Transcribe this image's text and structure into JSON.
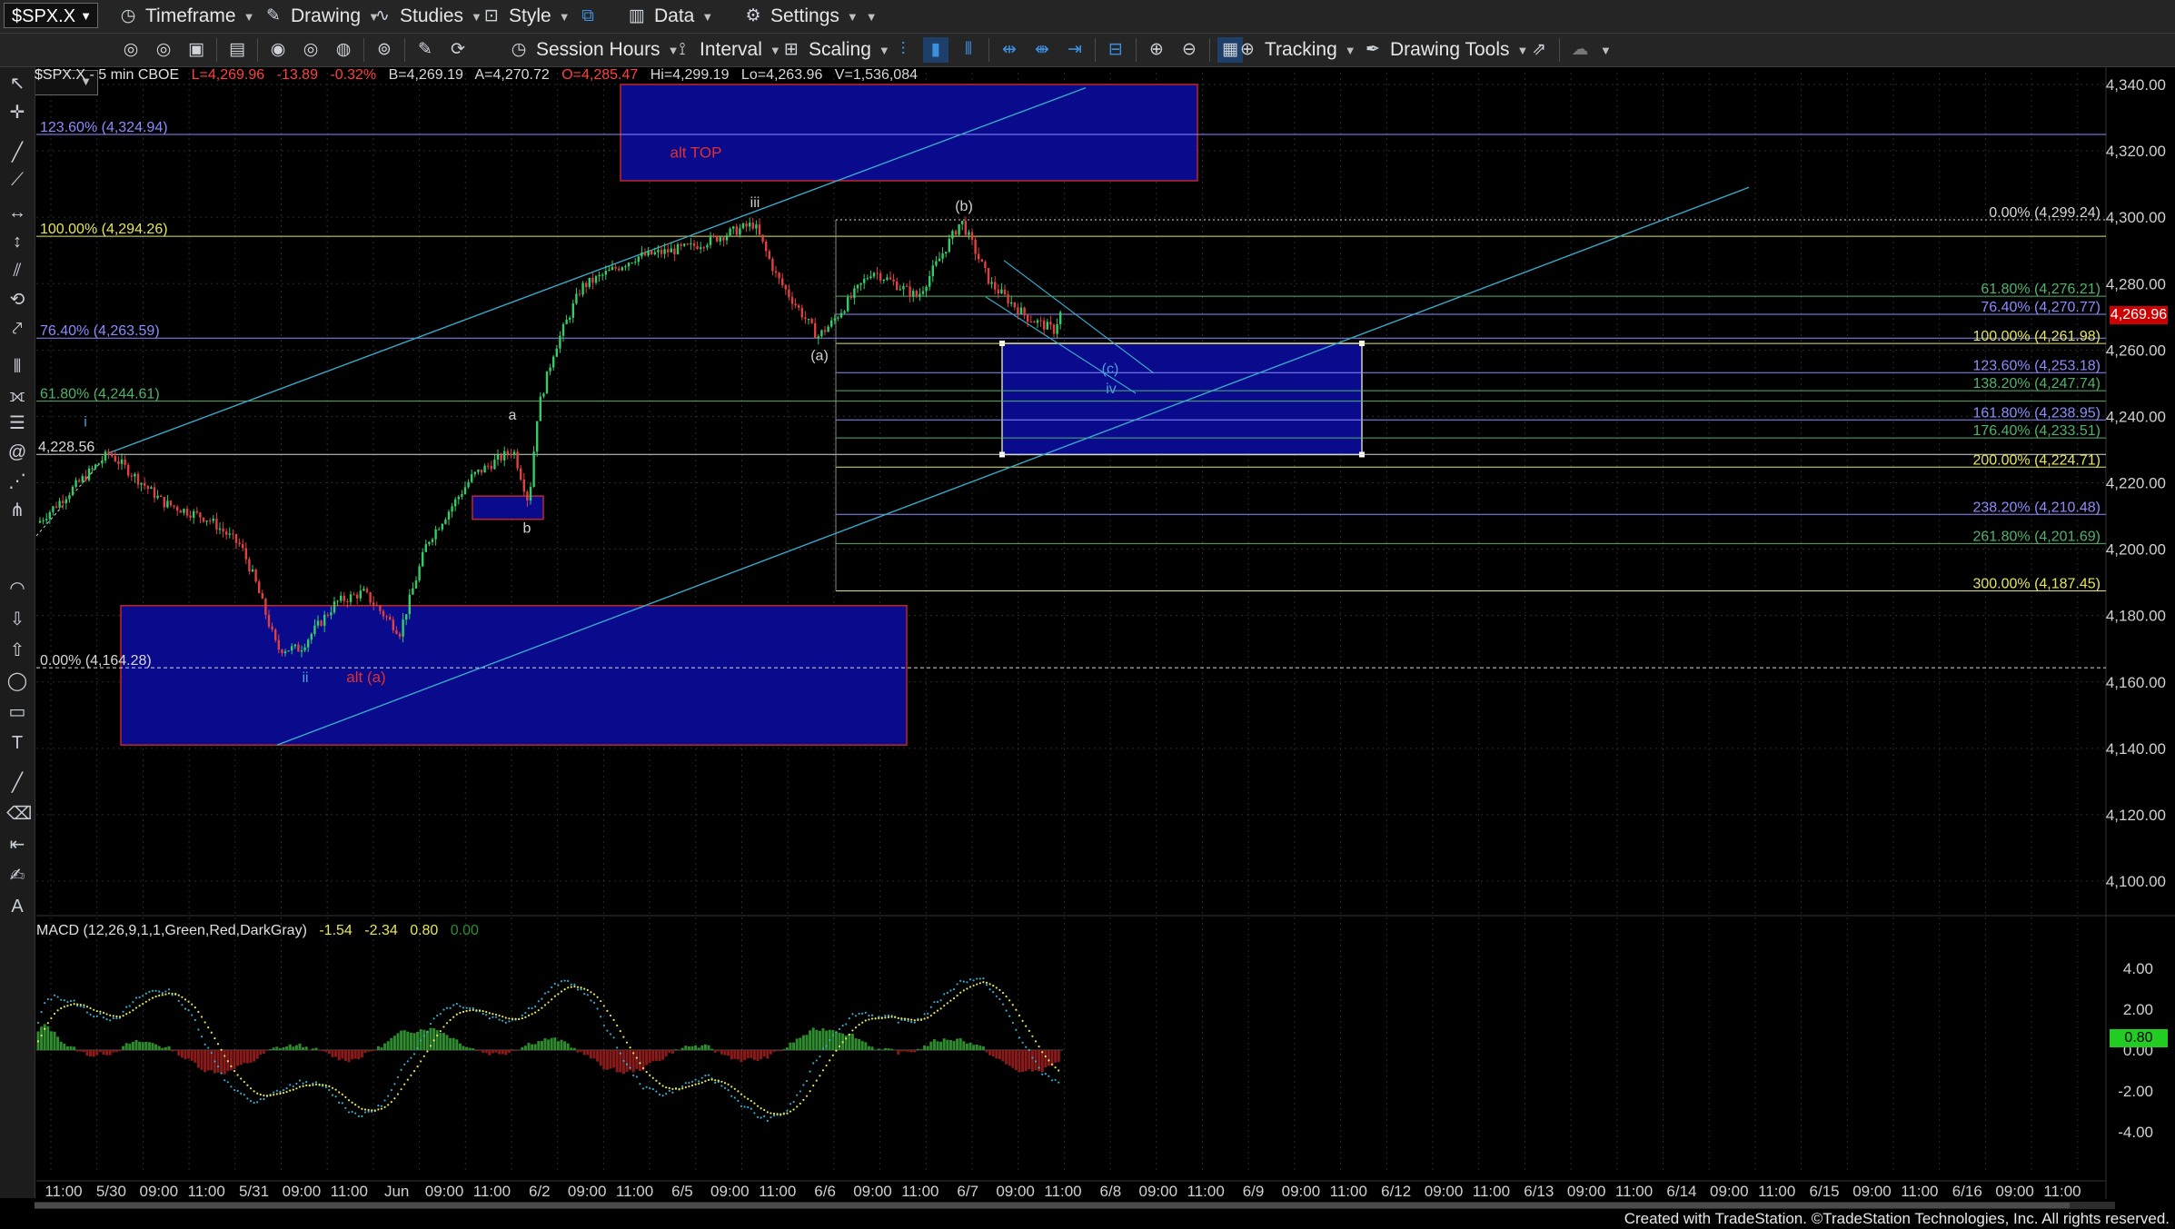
{
  "toolbar1": {
    "symbol": "$SPX.X",
    "timeframe": "Timeframe",
    "drawing": "Drawing",
    "studies": "Studies",
    "style": "Style",
    "data": "Data",
    "settings": "Settings"
  },
  "toolbar2": {
    "session_hours": "Session Hours",
    "interval": "Interval",
    "scaling": "Scaling",
    "tracking": "Tracking",
    "drawing_tools": "Drawing Tools"
  },
  "status": {
    "symbol_info": "$SPX.X - 5 min  CBOE",
    "last": "L=4,269.96",
    "net_change": "-13.89",
    "pct_change": "-0.32%",
    "bid": "B=4,269.19",
    "ask": "A=4,270.72",
    "open": "O=4,285.47",
    "high": "Hi=4,299.19",
    "low": "Lo=4,263.96",
    "volume": "V=1,536,084"
  },
  "macd": {
    "label": "MACD (12,26,9,1,1,Green,Red,DarkGray)",
    "v1": "-1.54",
    "v2": "-2.34",
    "v3": "0.80",
    "v4": "0.00",
    "value_box": "0.80"
  },
  "price_axis": {
    "ticks": [
      "4,340.00",
      "4,320.00",
      "4,300.00",
      "4,280.00",
      "4,260.00",
      "4,240.00",
      "4,220.00",
      "4,200.00",
      "4,180.00",
      "4,160.00",
      "4,140.00",
      "4,120.00",
      "4,100.00"
    ],
    "current_price": "4,269.96"
  },
  "macd_axis": {
    "ticks": [
      "4.00",
      "2.00",
      "0.00",
      "-2.00",
      "-4.00"
    ]
  },
  "time_axis": {
    "labels": [
      "11:00",
      "5/30",
      "09:00",
      "11:00",
      "5/31",
      "09:00",
      "11:00",
      "Jun",
      "09:00",
      "11:00",
      "6/2",
      "09:00",
      "11:00",
      "6/5",
      "09:00",
      "11:00",
      "6/6",
      "09:00",
      "11:00",
      "6/7",
      "09:00",
      "11:00",
      "6/8",
      "09:00",
      "11:00",
      "6/9",
      "09:00",
      "11:00",
      "6/12",
      "09:00",
      "11:00",
      "6/13",
      "09:00",
      "11:00",
      "6/14",
      "09:00",
      "11:00",
      "6/15",
      "09:00",
      "11:00",
      "6/16",
      "09:00",
      "11:00"
    ]
  },
  "fib_left": [
    {
      "label": "123.60% (4,324.94)",
      "color": "#8c8cff"
    },
    {
      "label": "100.00% (4,294.26)",
      "color": "#e6e65a"
    },
    {
      "label": "76.40% (4,263.59)",
      "color": "#8c8cff"
    },
    {
      "label": "61.80% (4,244.61)",
      "color": "#4fb36a"
    },
    {
      "label": "4,228.56",
      "color": "#d8d8d8"
    },
    {
      "label": "0.00% (4,164.28)",
      "color": "#d8d8d8"
    }
  ],
  "fib_right": [
    {
      "label": "0.00% (4,299.24)",
      "color": "#d8d8d8"
    },
    {
      "label": "61.80% (4,276.21)",
      "color": "#4fb36a"
    },
    {
      "label": "76.40% (4,270.77)",
      "color": "#8c8cff"
    },
    {
      "label": "100.00% (4,261.98)",
      "color": "#e6e65a"
    },
    {
      "label": "123.60% (4,253.18)",
      "color": "#8c8cff"
    },
    {
      "label": "138.20% (4,247.74)",
      "color": "#4fb36a"
    },
    {
      "label": "161.80% (4,238.95)",
      "color": "#8c8cff"
    },
    {
      "label": "176.40% (4,233.51)",
      "color": "#4fb36a"
    },
    {
      "label": "200.00% (4,224.71)",
      "color": "#e6e65a"
    },
    {
      "label": "238.20% (4,210.48)",
      "color": "#8c8cff"
    },
    {
      "label": "261.80% (4,201.69)",
      "color": "#4fb36a"
    },
    {
      "label": "300.00% (4,187.45)",
      "color": "#e6e65a"
    }
  ],
  "wave_labels": {
    "i": "i",
    "ii": "ii",
    "iii": "iii",
    "a": "a",
    "b": "b",
    "wa": "(a)",
    "wb": "(b)",
    "wc": "(c)",
    "iv": "iv",
    "alt_top": "alt TOP",
    "alt_a": "alt (a)"
  },
  "footer": "Created with TradeStation. ©TradeStation Technologies, Inc. All rights reserved.",
  "colors": {
    "up": "#33cc66",
    "down": "#e04040",
    "box_fill": "#0a0a8c",
    "box_border": "#c02828",
    "channel": "#39a9c9",
    "macd_line": "#39a9c9",
    "signal_line": "#e6e65a",
    "hist_up": "#2e8b2e",
    "hist_down": "#8b1a1a",
    "current_price_bg": "#cc0000",
    "macd_box_bg": "#22cc22"
  }
}
